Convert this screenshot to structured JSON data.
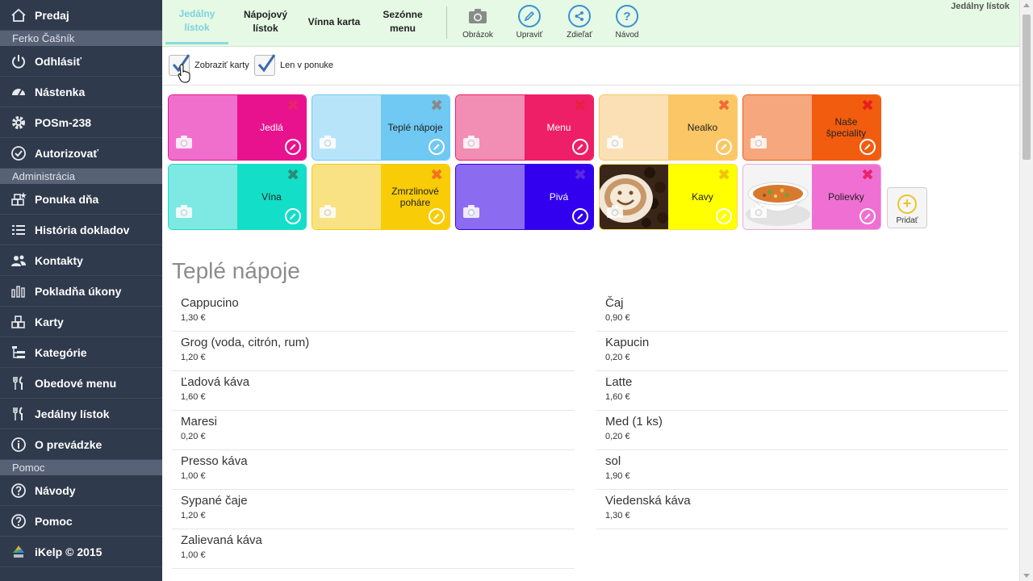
{
  "sidebar": {
    "top_item": {
      "label": "Predaj",
      "icon": "home-icon"
    },
    "user_section": "Ferko Čašník",
    "user_items": [
      {
        "label": "Odhlásiť",
        "icon": "power-icon"
      },
      {
        "label": "Nástenka",
        "icon": "dashboard-icon"
      },
      {
        "label": "POSm-238",
        "icon": "gear-icon"
      },
      {
        "label": "Autorizovať",
        "icon": "check-circle-icon"
      }
    ],
    "admin_section": "Administrácia",
    "admin_items": [
      {
        "label": "Ponuka dňa",
        "icon": "daily-offer-icon"
      },
      {
        "label": "História dokladov",
        "icon": "list-icon"
      },
      {
        "label": "Kontakty",
        "icon": "users-icon"
      },
      {
        "label": "Pokladňa úkony",
        "icon": "bar-chart-icon"
      },
      {
        "label": "Karty",
        "icon": "cards-icon"
      },
      {
        "label": "Kategórie",
        "icon": "tree-icon"
      },
      {
        "label": "Obedové menu",
        "icon": "cutlery-icon"
      },
      {
        "label": "Jedálny lístok",
        "icon": "cutlery-icon"
      },
      {
        "label": "O prevádzke",
        "icon": "info-icon"
      }
    ],
    "help_section": "Pomoc",
    "help_items": [
      {
        "label": "Návody",
        "icon": "question-icon"
      },
      {
        "label": "Pomoc",
        "icon": "question-icon"
      },
      {
        "label": "iKelp © 2015",
        "icon": "ikelp-logo-icon"
      }
    ]
  },
  "toolbar": {
    "tabs": [
      {
        "label": "Jedálny lístok",
        "active": true
      },
      {
        "label": "Nápojový lístok",
        "active": false
      },
      {
        "label": "Vínna karta",
        "active": false
      },
      {
        "label": "Sezónne menu",
        "active": false
      }
    ],
    "actions": [
      {
        "label": "Obrázok",
        "icon": "camera-icon"
      },
      {
        "label": "Upraviť",
        "icon": "pencil-icon"
      },
      {
        "label": "Zdieľať",
        "icon": "share-icon"
      },
      {
        "label": "Návod",
        "icon": "question-icon"
      }
    ],
    "page_label": "Jedálny lístok"
  },
  "options": {
    "show_cards": {
      "label": "Zobraziť karty",
      "checked": true
    },
    "only_in_menu": {
      "label": "Len v ponuke",
      "checked": true
    }
  },
  "tiles": [
    {
      "label": "Jedlá",
      "light": "#f06fcd",
      "dark": "#e8128e",
      "x_color": "#e8246a",
      "photo": ""
    },
    {
      "label": "Teplé nápoje",
      "light": "#b8e4fa",
      "dark": "#6fc9f2",
      "x_color": "#8a8a8a",
      "photo": ""
    },
    {
      "label": "Menu",
      "light": "#f28db3",
      "dark": "#ee1f66",
      "x_color": "#e8203f",
      "photo": ""
    },
    {
      "label": "Nealko",
      "light": "#fae0b4",
      "dark": "#fbc766",
      "x_color": "#f26a36",
      "photo": ""
    },
    {
      "label": "Naše špeciality",
      "light": "#f6a77e",
      "dark": "#f15c0e",
      "x_color": "#e81e1e",
      "photo": ""
    },
    {
      "label": "Vína",
      "light": "#7ee8e3",
      "dark": "#13dec8",
      "x_color": "#2d8a78",
      "photo": ""
    },
    {
      "label": "Zmrzlinové poháre",
      "light": "#f9e283",
      "dark": "#f8cc07",
      "x_color": "#f5721e",
      "photo": ""
    },
    {
      "label": "Pivá",
      "light": "#8b6cf0",
      "dark": "#3200ee",
      "x_color": "#5a2bdc",
      "photo": ""
    },
    {
      "label": "Kavy",
      "light": "#f2f2f2",
      "dark": "#ffff00",
      "x_color": "#f0c20e",
      "photo": "coffee"
    },
    {
      "label": "Polievky",
      "light": "#f2f2f2",
      "dark": "#f06fd2",
      "x_color": "#e8246a",
      "photo": "soup"
    }
  ],
  "add_button": {
    "label": "Pridať",
    "icon": "plus-icon"
  },
  "list": {
    "title": "Teplé nápoje",
    "left": [
      {
        "name": "Cappucino",
        "price": "1,30 €"
      },
      {
        "name": "Grog (voda, citrón, rum)",
        "price": "1,20 €"
      },
      {
        "name": "Ľadová káva",
        "price": "1,60 €"
      },
      {
        "name": "Maresi",
        "price": "0,20 €"
      },
      {
        "name": "Presso káva",
        "price": "1,00 €"
      },
      {
        "name": "Sypané čaje",
        "price": "1,20 €"
      },
      {
        "name": "Zalievaná káva",
        "price": "1,00 €"
      }
    ],
    "right": [
      {
        "name": "Čaj",
        "price": "0,90 €"
      },
      {
        "name": "Kapucin",
        "price": "0,20 €"
      },
      {
        "name": "Latte",
        "price": "1,60 €"
      },
      {
        "name": "Med (1 ks)",
        "price": "0,20 €"
      },
      {
        "name": "sol",
        "price": "1,90 €"
      },
      {
        "name": "Viedenská káva",
        "price": "1,30 €"
      }
    ]
  }
}
